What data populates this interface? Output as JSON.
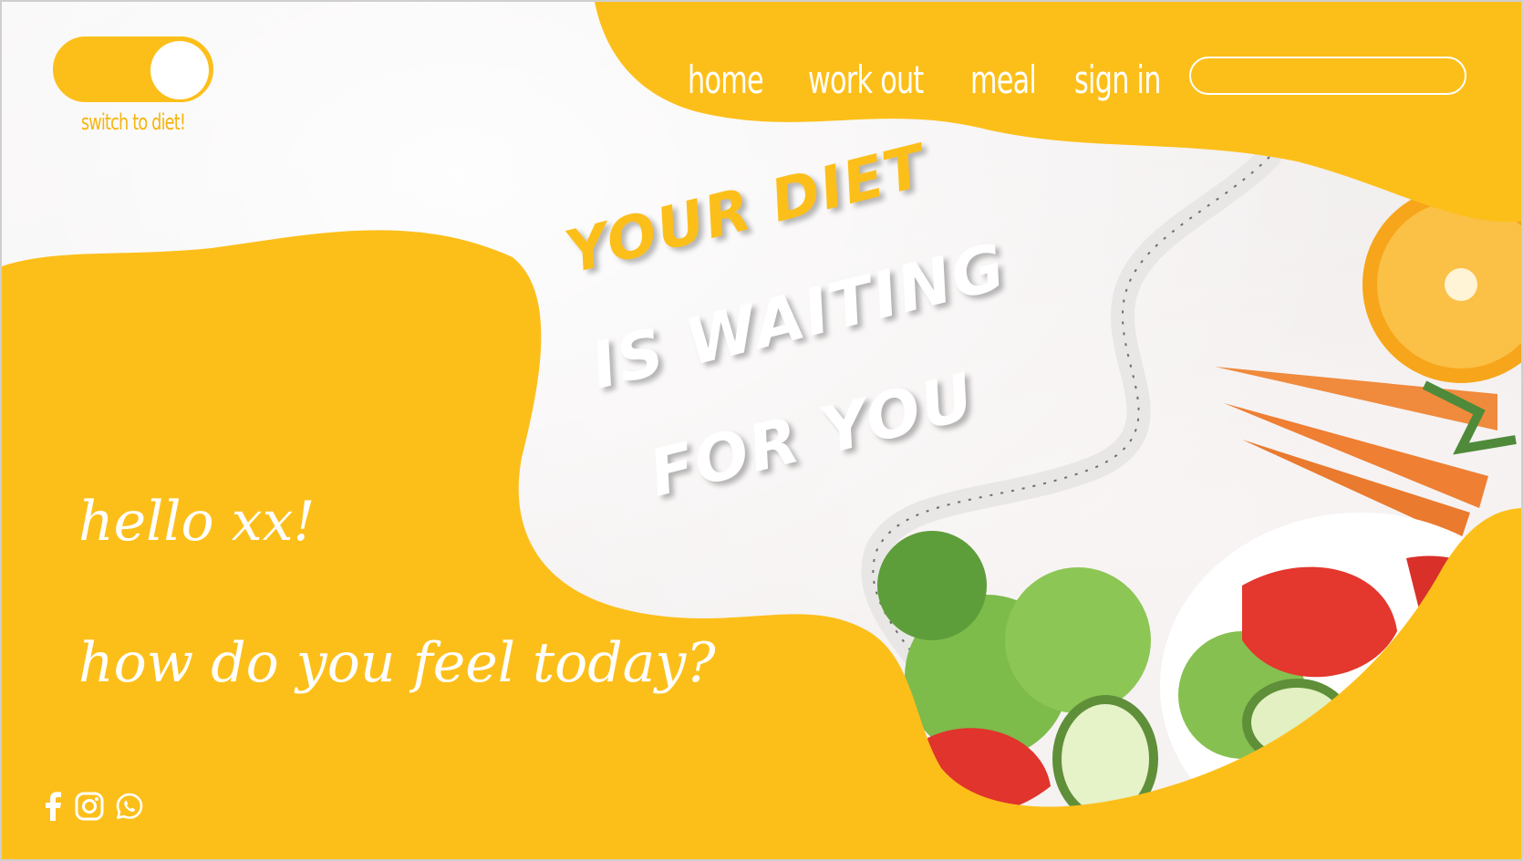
{
  "toggle": {
    "label": "switch to diet!",
    "state": "on"
  },
  "nav": {
    "items": [
      {
        "label": "home"
      },
      {
        "label": "work out"
      },
      {
        "label": "meal"
      },
      {
        "label": "sign in"
      }
    ],
    "search": {
      "value": "",
      "placeholder": ""
    }
  },
  "hero": {
    "line1": "YOUR DIET",
    "line2": "IS WAITING",
    "line3": "FOR YOU"
  },
  "greeting": {
    "hello": "hello xx!",
    "question": "how do you feel today?"
  },
  "social": [
    {
      "icon": "facebook-icon"
    },
    {
      "icon": "instagram-icon"
    },
    {
      "icon": "whatsapp-icon"
    }
  ],
  "colors": {
    "accent": "#fcbf1a",
    "background": "#f5f3f2",
    "text_light": "#ffffff"
  }
}
